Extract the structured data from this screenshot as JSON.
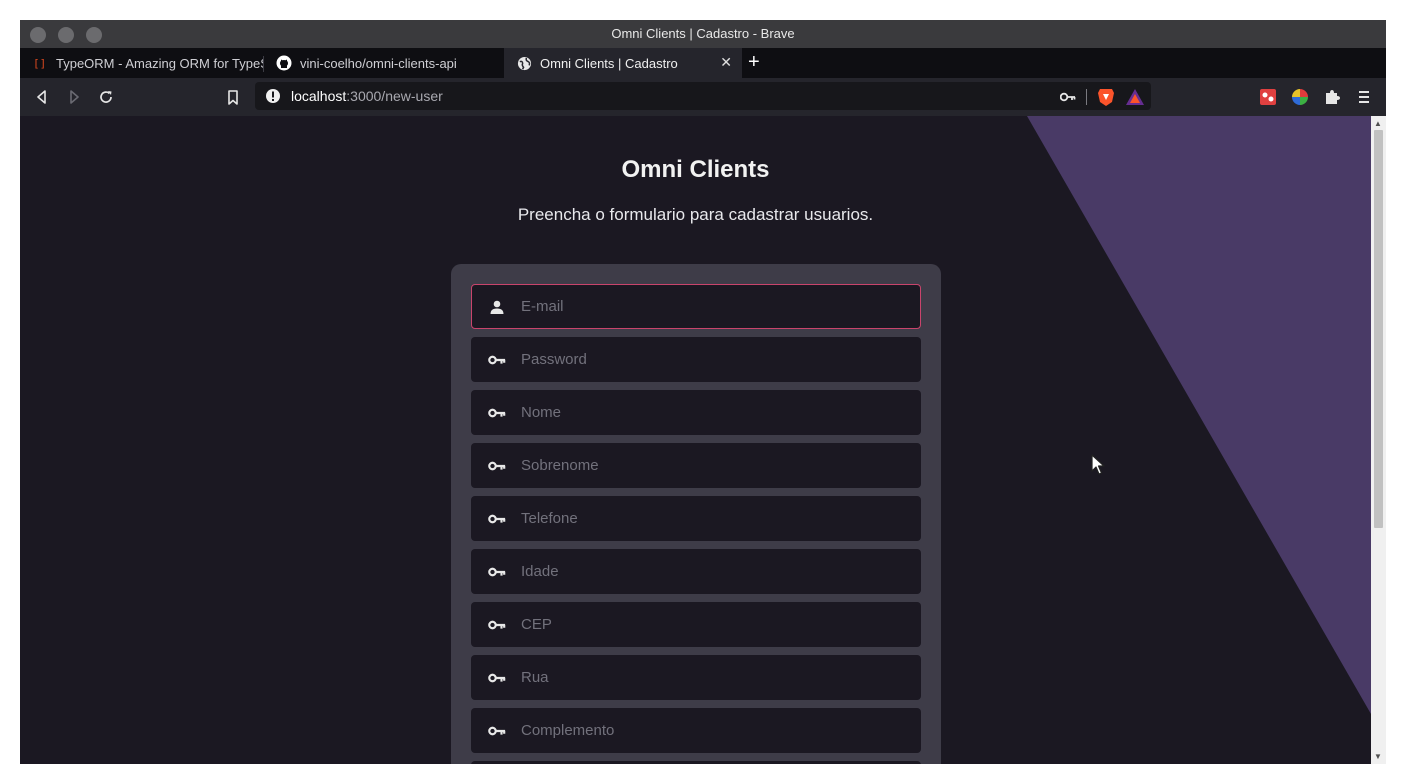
{
  "window": {
    "title": "Omni Clients | Cadastro - Brave"
  },
  "tabs": [
    {
      "label": "TypeORM - Amazing ORM for TypeScript and JavaScript",
      "favicon": "typeorm-icon"
    },
    {
      "label": "vini-coelho/omni-clients-api",
      "favicon": "github-icon"
    },
    {
      "label": "Omni Clients | Cadastro",
      "favicon": "globe-icon",
      "active": true
    }
  ],
  "address_bar": {
    "host": "localhost",
    "path": ":3000/new-user"
  },
  "page": {
    "title": "Omni Clients",
    "subtitle": "Preencha o formulario para cadastrar usuarios.",
    "fields": [
      {
        "placeholder": "E-mail",
        "icon": "user-icon",
        "focused": true
      },
      {
        "placeholder": "Password",
        "icon": "key-icon"
      },
      {
        "placeholder": "Nome",
        "icon": "key-icon"
      },
      {
        "placeholder": "Sobrenome",
        "icon": "key-icon"
      },
      {
        "placeholder": "Telefone",
        "icon": "key-icon"
      },
      {
        "placeholder": "Idade",
        "icon": "key-icon"
      },
      {
        "placeholder": "CEP",
        "icon": "key-icon"
      },
      {
        "placeholder": "Rua",
        "icon": "key-icon"
      },
      {
        "placeholder": "Complemento",
        "icon": "key-icon"
      },
      {
        "placeholder": "",
        "icon": "key-icon"
      }
    ]
  },
  "colors": {
    "page_background": "#1b1822",
    "accent_shape": "#493a66",
    "card_background": "#3e3c48",
    "input_background": "#1b1822",
    "focus_border": "#c9446c"
  }
}
